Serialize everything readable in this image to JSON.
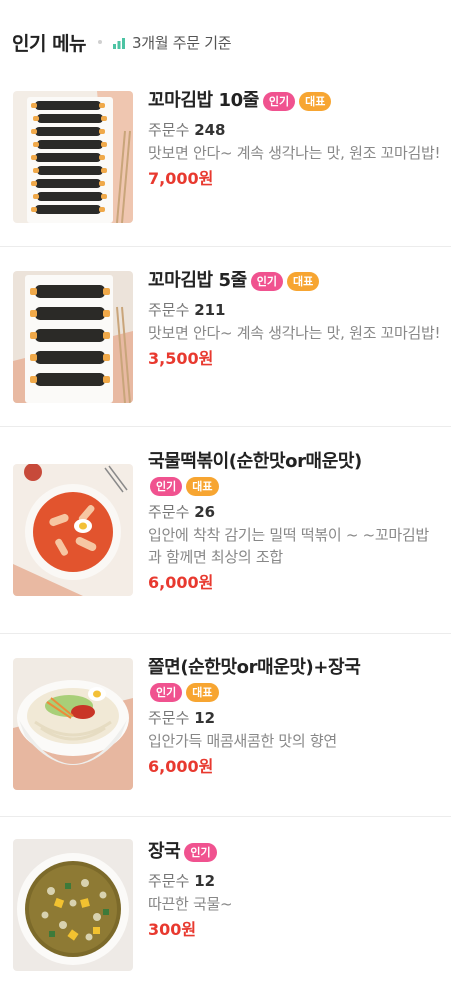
{
  "header": {
    "title": "인기 메뉴",
    "subtitle": "3개월 주문 기준",
    "icon": "bar-chart-icon",
    "icon_color": "#4cc3a3"
  },
  "labels": {
    "orders_prefix": "주문수"
  },
  "colors": {
    "price": "#e8392f",
    "badge_popular": "#f0528f",
    "badge_signature": "#f7a531"
  },
  "menu": [
    {
      "name": "꼬마김밥 10줄",
      "badges": [
        "인기",
        "대표"
      ],
      "orders": "248",
      "description": "맛보면 안다~ 계속 생각나는 맛, 원조 꼬마김밥!",
      "price": "7,000원"
    },
    {
      "name": "꼬마김밥 5줄",
      "badges": [
        "인기",
        "대표"
      ],
      "orders": "211",
      "description": "맛보면 안다~ 계속 생각나는 맛, 원조 꼬마김밥!",
      "price": "3,500원"
    },
    {
      "name": "국물떡볶이(순한맛or매운맛)",
      "badges": [
        "인기",
        "대표"
      ],
      "orders": "26",
      "description": "입안에 착착 감기는 밀떡 떡볶이 ~ ~꼬마김밥과 함께면 최상의 조합",
      "price": "6,000원"
    },
    {
      "name": "쫄면(순한맛or매운맛)+장국",
      "badges": [
        "인기",
        "대표"
      ],
      "orders": "12",
      "description": "입안가득 매콤새콤한 맛의 향연",
      "price": "6,000원"
    },
    {
      "name": "장국",
      "badges": [
        "인기"
      ],
      "orders": "12",
      "description": "따끈한 국물~",
      "price": "300원"
    }
  ]
}
